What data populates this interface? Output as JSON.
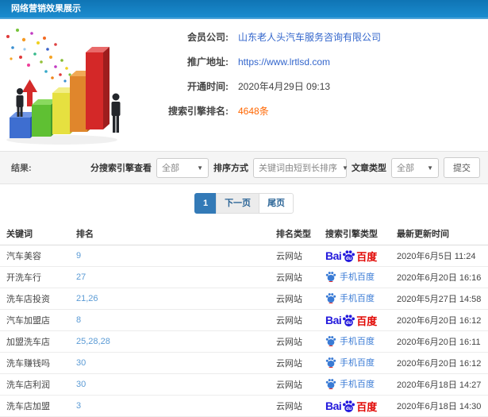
{
  "header": {
    "title": "网络营销效果展示",
    "bg_color": "#1787cb"
  },
  "info": {
    "fields": [
      {
        "label": "会员公司:",
        "value": "山东老人头汽车服务咨询有限公司"
      },
      {
        "label": "推广地址:",
        "value": "https://www.lrtlsd.com"
      },
      {
        "label": "开通时间:",
        "value": "2020年4月29日 09:13"
      },
      {
        "label": "搜索引擎排名:",
        "value": "4648条"
      }
    ]
  },
  "filters": {
    "result_label": "结果:",
    "engine_label": "分搜索引擎查看",
    "engine_value": "全部",
    "sort_label": "排序方式",
    "sort_value": "关键词由短到长排序",
    "article_label": "文章类型",
    "article_value": "全部",
    "submit_label": "提交"
  },
  "pagination": {
    "current": "1",
    "next": "下一页",
    "last": "尾页"
  },
  "table": {
    "columns": [
      "关键词",
      "排名",
      "排名类型",
      "搜索引擎类型",
      "最新更新时间"
    ],
    "rows": [
      {
        "keyword": "汽车美容",
        "rank": "9",
        "rank_type": "云网站",
        "engine": "baidu",
        "updated": "2020年6月5日 11:24"
      },
      {
        "keyword": "开洗车行",
        "rank": "27",
        "rank_type": "云网站",
        "engine": "baidu_mobile",
        "updated": "2020年6月20日 16:16"
      },
      {
        "keyword": "洗车店投资",
        "rank": "21,26",
        "rank_type": "云网站",
        "engine": "baidu_mobile",
        "updated": "2020年5月27日 14:58"
      },
      {
        "keyword": "汽车加盟店",
        "rank": "8",
        "rank_type": "云网站",
        "engine": "baidu",
        "updated": "2020年6月20日 16:12"
      },
      {
        "keyword": "加盟洗车店",
        "rank": "25,28,28",
        "rank_type": "云网站",
        "engine": "baidu_mobile",
        "updated": "2020年6月20日 16:11"
      },
      {
        "keyword": "洗车赚钱吗",
        "rank": "30",
        "rank_type": "云网站",
        "engine": "baidu_mobile",
        "updated": "2020年6月20日 16:12"
      },
      {
        "keyword": "洗车店利润",
        "rank": "30",
        "rank_type": "云网站",
        "engine": "baidu_mobile",
        "updated": "2020年6月18日 14:27"
      },
      {
        "keyword": "洗车店加盟",
        "rank": "3",
        "rank_type": "云网站",
        "engine": "baidu",
        "updated": "2020年6月18日 14:30"
      }
    ]
  },
  "engine_logos": {
    "baidu": {
      "latin": "Bai",
      "cn": "百度"
    },
    "baidu_mobile": {
      "text": "手机百度"
    }
  },
  "colors": {
    "link_blue": "#3366cc",
    "rank_blue": "#5b9bd5",
    "highlight_orange": "#ff6600",
    "active_page_blue": "#337ab7",
    "baidu_blue": "#2319dc",
    "baidu_red": "#e10602",
    "mobile_baidu_blue": "#3a7bd5"
  }
}
